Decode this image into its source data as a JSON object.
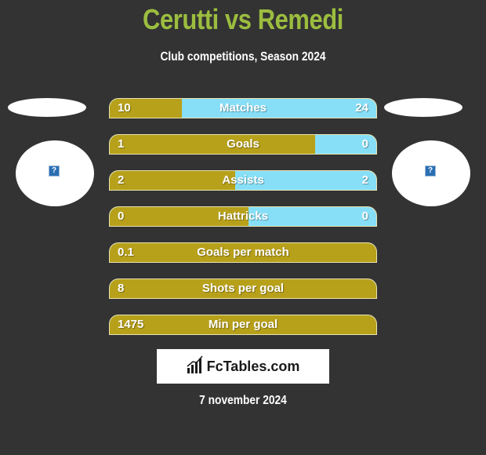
{
  "header": {
    "title": "Cerutti vs Remedi",
    "subtitle": "Club competitions, Season 2024"
  },
  "teams": {
    "left": {
      "logo_icon": "image-placeholder-icon",
      "logo_glyph": "?"
    },
    "right": {
      "logo_icon": "image-placeholder-icon",
      "logo_glyph": "?"
    }
  },
  "colors": {
    "title": "#9cbd3f",
    "left_bar": "#b8a11a",
    "right_bar": "#87dff7",
    "background": "#333333"
  },
  "stats": [
    {
      "label": "Matches",
      "left": "10",
      "right": "24",
      "left_fraction": 0.27
    },
    {
      "label": "Goals",
      "left": "1",
      "right": "0",
      "left_fraction": 0.77
    },
    {
      "label": "Assists",
      "left": "2",
      "right": "2",
      "left_fraction": 0.47
    },
    {
      "label": "Hattricks",
      "left": "0",
      "right": "0",
      "left_fraction": 0.52
    },
    {
      "label": "Goals per match",
      "left": "0.1",
      "right": "",
      "left_fraction": 1.0
    },
    {
      "label": "Shots per goal",
      "left": "8",
      "right": "",
      "left_fraction": 1.0
    },
    {
      "label": "Min per goal",
      "left": "1475",
      "right": "",
      "left_fraction": 1.0
    }
  ],
  "footer": {
    "brand": "FcTables.com",
    "brand_icon": "bar-chart-icon",
    "date": "7 november 2024"
  }
}
